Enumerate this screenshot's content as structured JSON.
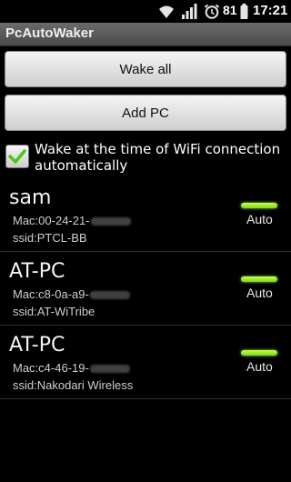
{
  "status_bar": {
    "battery_percent": "81",
    "time": "17:21",
    "icons": [
      "wifi-icon",
      "signal-icon",
      "alarm-icon",
      "battery-icon"
    ]
  },
  "app": {
    "title": "PcAutoWaker"
  },
  "buttons": {
    "wake_all": "Wake all",
    "add_pc": "Add PC"
  },
  "option": {
    "label": "Wake at the time of WiFi connection automatically",
    "checked": true
  },
  "pcs": [
    {
      "name": "sam",
      "mac": "Mac:00-24-21-",
      "ssid": "ssid:PTCL-BB",
      "mode": "Auto"
    },
    {
      "name": "AT-PC",
      "mac": "Mac:c8-0a-a9-",
      "ssid": "ssid:AT-WiTribe",
      "mode": "Auto"
    },
    {
      "name": "AT-PC",
      "mac": "Mac:c4-46-19-",
      "ssid": "ssid:Nakodari Wireless",
      "mode": "Auto"
    }
  ],
  "colors": {
    "indicator_on": "#8fe83b",
    "title_bar": "#5a5a5a",
    "background": "#000000"
  }
}
